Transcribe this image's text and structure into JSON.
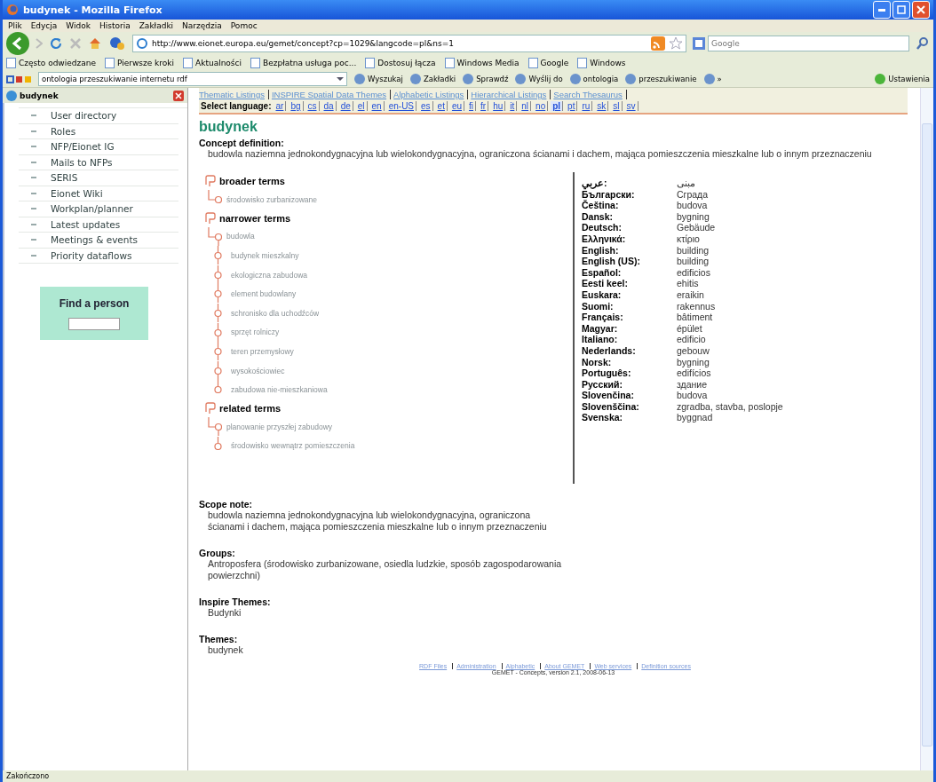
{
  "window": {
    "title": "budynek - Mozilla Firefox"
  },
  "menu": [
    "Plik",
    "Edycja",
    "Widok",
    "Historia",
    "Zakładki",
    "Narzędzia",
    "Pomoc"
  ],
  "nav": {
    "url": "http://www.eionet.europa.eu/gemet/concept?cp=1029&langcode=pl&ns=1",
    "search_placeholder": "Google"
  },
  "bookmarks": [
    "Często odwiedzane",
    "Pierwsze kroki",
    "Aktualności",
    "Bezpłatna usługa poc...",
    "Dostosuj łącza",
    "Windows Media",
    "Google",
    "Windows"
  ],
  "google_toolbar": {
    "query": "ontologia przeszukiwanie internetu rdf",
    "buttons": [
      "Wyszukaj",
      "Zakładki",
      "Sprawdź",
      "Wyślij do",
      "ontologia",
      "przeszukiwanie",
      "»"
    ],
    "settings": "Ustawienia"
  },
  "sidebar": {
    "title": "budynek",
    "items": [
      "User directory",
      "Roles",
      "NFP/Eionet IG",
      "Mails to NFPs",
      "SERIS",
      "Eionet Wiki",
      "Workplan/planner",
      "Latest updates",
      "Meetings & events",
      "Priority dataflows"
    ],
    "find_person": "Find a person"
  },
  "page": {
    "top_links": [
      "Thematic Listings",
      "INSPIRE Spatial Data Themes",
      "Alphabetic Listings",
      "Hierarchical Listings",
      "Search Thesaurus"
    ],
    "language_label": "Select language:",
    "languages": [
      {
        "code": "ar",
        "selected": false
      },
      {
        "code": "bg",
        "selected": false
      },
      {
        "code": "cs",
        "selected": false
      },
      {
        "code": "da",
        "selected": false
      },
      {
        "code": "de",
        "selected": false
      },
      {
        "code": "el",
        "selected": false
      },
      {
        "code": "en",
        "selected": false
      },
      {
        "code": "en-US",
        "selected": false
      },
      {
        "code": "es",
        "selected": false
      },
      {
        "code": "et",
        "selected": false
      },
      {
        "code": "eu",
        "selected": false
      },
      {
        "code": "fi",
        "selected": false
      },
      {
        "code": "fr",
        "selected": false
      },
      {
        "code": "hu",
        "selected": false
      },
      {
        "code": "it",
        "selected": false
      },
      {
        "code": "nl",
        "selected": false
      },
      {
        "code": "no",
        "selected": false
      },
      {
        "code": "pl",
        "selected": true
      },
      {
        "code": "pt",
        "selected": false
      },
      {
        "code": "ru",
        "selected": false
      },
      {
        "code": "sk",
        "selected": false
      },
      {
        "code": "sl",
        "selected": false
      },
      {
        "code": "sv",
        "selected": false
      }
    ],
    "heading": "budynek",
    "definition_label": "Concept definition:",
    "definition": "budowla naziemna jednokondygnacyjna lub wielokondygnacyjna, ograniczona ścianami i dachem, mająca pomieszczenia mieszkalne lub o innym przeznaczeniu",
    "term_groups": [
      {
        "title": "broader terms",
        "terms": [
          "środowisko zurbanizowane"
        ]
      },
      {
        "title": "narrower terms",
        "terms": [
          "budowla",
          "budynek mieszkalny",
          "ekologiczna zabudowa",
          "element budowlany",
          "schronisko dla uchodźców",
          "sprzęt rolniczy",
          "teren przemysłowy",
          "wysokościowiec",
          "zabudowa nie-mieszkaniowa"
        ]
      },
      {
        "title": "related terms",
        "terms": [
          "planowanie przyszłej zabudowy",
          "środowisko wewnątrz pomieszczenia"
        ]
      }
    ],
    "translations": [
      {
        "language": "عربي:",
        "term": "مبنى"
      },
      {
        "language": "Български:",
        "term": "Сграда"
      },
      {
        "language": "Čeština:",
        "term": "budova"
      },
      {
        "language": "Dansk:",
        "term": "bygning"
      },
      {
        "language": "Deutsch:",
        "term": "Gebäude"
      },
      {
        "language": "Ελληνικά:",
        "term": "κτίριο"
      },
      {
        "language": "English:",
        "term": "building"
      },
      {
        "language": "English (US):",
        "term": "building"
      },
      {
        "language": "Español:",
        "term": "edificios"
      },
      {
        "language": "Eesti keel:",
        "term": "ehitis"
      },
      {
        "language": "Euskara:",
        "term": "eraikin"
      },
      {
        "language": "Suomi:",
        "term": "rakennus"
      },
      {
        "language": "Français:",
        "term": "bâtiment"
      },
      {
        "language": "Magyar:",
        "term": "épület"
      },
      {
        "language": "Italiano:",
        "term": "edificio"
      },
      {
        "language": "Nederlands:",
        "term": "gebouw"
      },
      {
        "language": "Norsk:",
        "term": "bygning"
      },
      {
        "language": "Português:",
        "term": "edifícios"
      },
      {
        "language": "Русский:",
        "term": "здание"
      },
      {
        "language": "Slovenčina:",
        "term": "budova"
      },
      {
        "language": "Slovenščina:",
        "term": "zgradba, stavba, poslopje"
      },
      {
        "language": "Svenska:",
        "term": "byggnad"
      }
    ],
    "notes": [
      {
        "label": "Scope note:",
        "text": "budowla naziemna jednokondygnacyjna lub wielokondygnacyjna, ograniczona ścianami i dachem, mająca pomieszczenia mieszkalne lub o innym przeznaczeniu"
      },
      {
        "label": "Groups:",
        "text": "Antroposfera (środowisko zurbanizowane, osiedla ludzkie, sposób zagospodarowania powierzchni)"
      },
      {
        "label": "Inspire Themes:",
        "text": "Budynki"
      },
      {
        "label": "Themes:",
        "text": "budynek"
      }
    ],
    "footer_links": [
      "RDF Files",
      "Administration",
      "Alphabetic",
      "About GEMET",
      "Web services",
      "Definition sources"
    ],
    "footer": "GEMET - Concepts, version 2.1, 2008-06-13"
  },
  "status_bar": "Zakończono"
}
